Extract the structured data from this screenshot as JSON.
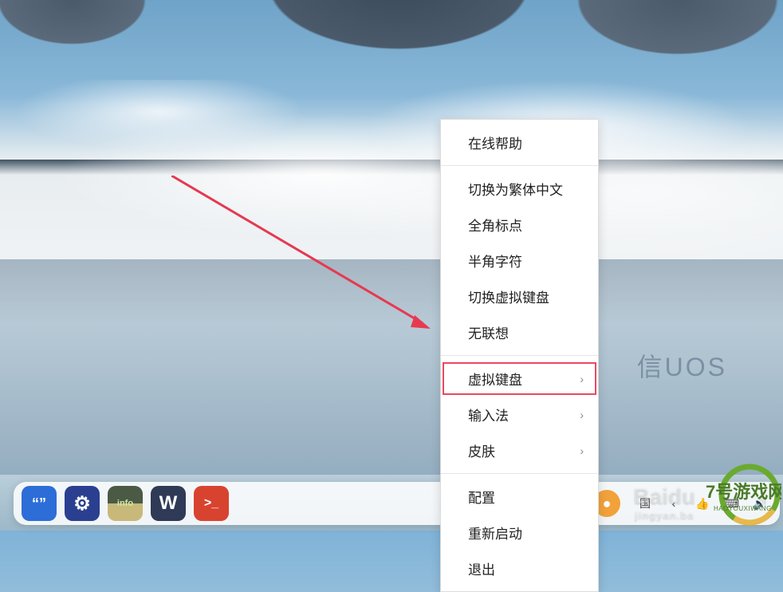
{
  "desktop": {
    "branding_text": "信UOS"
  },
  "context_menu": {
    "groups": [
      {
        "items": [
          {
            "label": "在线帮助",
            "submenu": false,
            "highlighted": false
          }
        ]
      },
      {
        "items": [
          {
            "label": "切换为繁体中文",
            "submenu": false,
            "highlighted": false
          },
          {
            "label": "全角标点",
            "submenu": false,
            "highlighted": false
          },
          {
            "label": "半角字符",
            "submenu": false,
            "highlighted": false
          },
          {
            "label": "切换虚拟键盘",
            "submenu": false,
            "highlighted": false
          },
          {
            "label": "无联想",
            "submenu": false,
            "highlighted": false
          }
        ]
      },
      {
        "items": [
          {
            "label": "虚拟键盘",
            "submenu": true,
            "highlighted": true
          },
          {
            "label": "输入法",
            "submenu": true,
            "highlighted": false
          },
          {
            "label": "皮肤",
            "submenu": true,
            "highlighted": false
          }
        ]
      },
      {
        "items": [
          {
            "label": "配置",
            "submenu": false,
            "highlighted": false
          },
          {
            "label": "重新启动",
            "submenu": false,
            "highlighted": false
          },
          {
            "label": "退出",
            "submenu": false,
            "highlighted": false
          }
        ]
      }
    ]
  },
  "dock": {
    "apps_left": [
      {
        "name": "quote-app-icon",
        "class": "icon-blue",
        "glyph": "“”"
      },
      {
        "name": "settings-app-icon",
        "class": "icon-darkblue",
        "glyph": "⚙"
      },
      {
        "name": "info-app-icon",
        "class": "icon-info",
        "glyph": "info"
      },
      {
        "name": "wps-app-icon",
        "class": "icon-wps",
        "glyph": "W"
      },
      {
        "name": "terminal-app-icon",
        "class": "icon-terminal",
        "glyph": ">_"
      }
    ],
    "apps_right": [
      {
        "name": "thunderbird-icon",
        "bg": "#1f7fd8",
        "glyph": "✦"
      },
      {
        "name": "browser-icon",
        "bg": "#f2a23a",
        "glyph": "●"
      }
    ],
    "tray": [
      {
        "name": "ime-tray-icon",
        "glyph": "国"
      },
      {
        "name": "back-tray-icon",
        "glyph": "‹"
      },
      {
        "name": "thumb-tray-icon",
        "glyph": "👍"
      },
      {
        "name": "keyboard-tray-icon",
        "glyph": "⌨"
      },
      {
        "name": "volume-tray-icon",
        "glyph": "🔊"
      }
    ]
  },
  "watermarks": {
    "baidu": "Baidu",
    "baidu_sub": "jingyan.ba",
    "site_main": "7号游戏网",
    "site_sub": "HAOYOUXIWANG"
  },
  "annotation": {
    "arrow_color": "#e63950"
  }
}
